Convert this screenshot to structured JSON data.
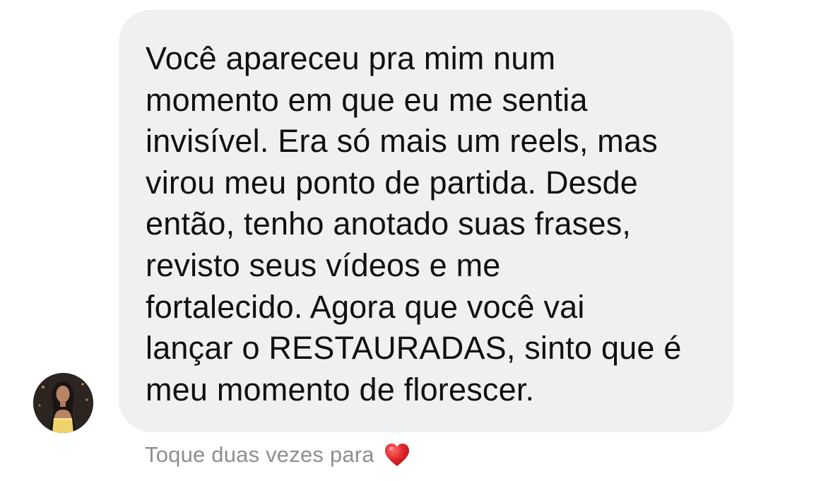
{
  "message": {
    "text": "Você apareceu pra mim num\nmomento em que eu me sentia\ninvisível. Era só mais um reels, mas\nvirou meu ponto de partida. Desde\nentão, tenho anotado suas frases,\nrevisto seus vídeos e me\nfortalecido. Agora que você vai\nlançar o RESTAURADAS, sinto que é\nmeu momento de florescer.",
    "bubble_color": "#eff0f2",
    "text_color": "#101010"
  },
  "sender": {
    "avatar_icon": "profile-photo"
  },
  "reaction_hint": {
    "text": "Toque duas vezes para",
    "icon": "heart-icon",
    "icon_color": "#e0262d",
    "text_color": "#8e8e93"
  }
}
